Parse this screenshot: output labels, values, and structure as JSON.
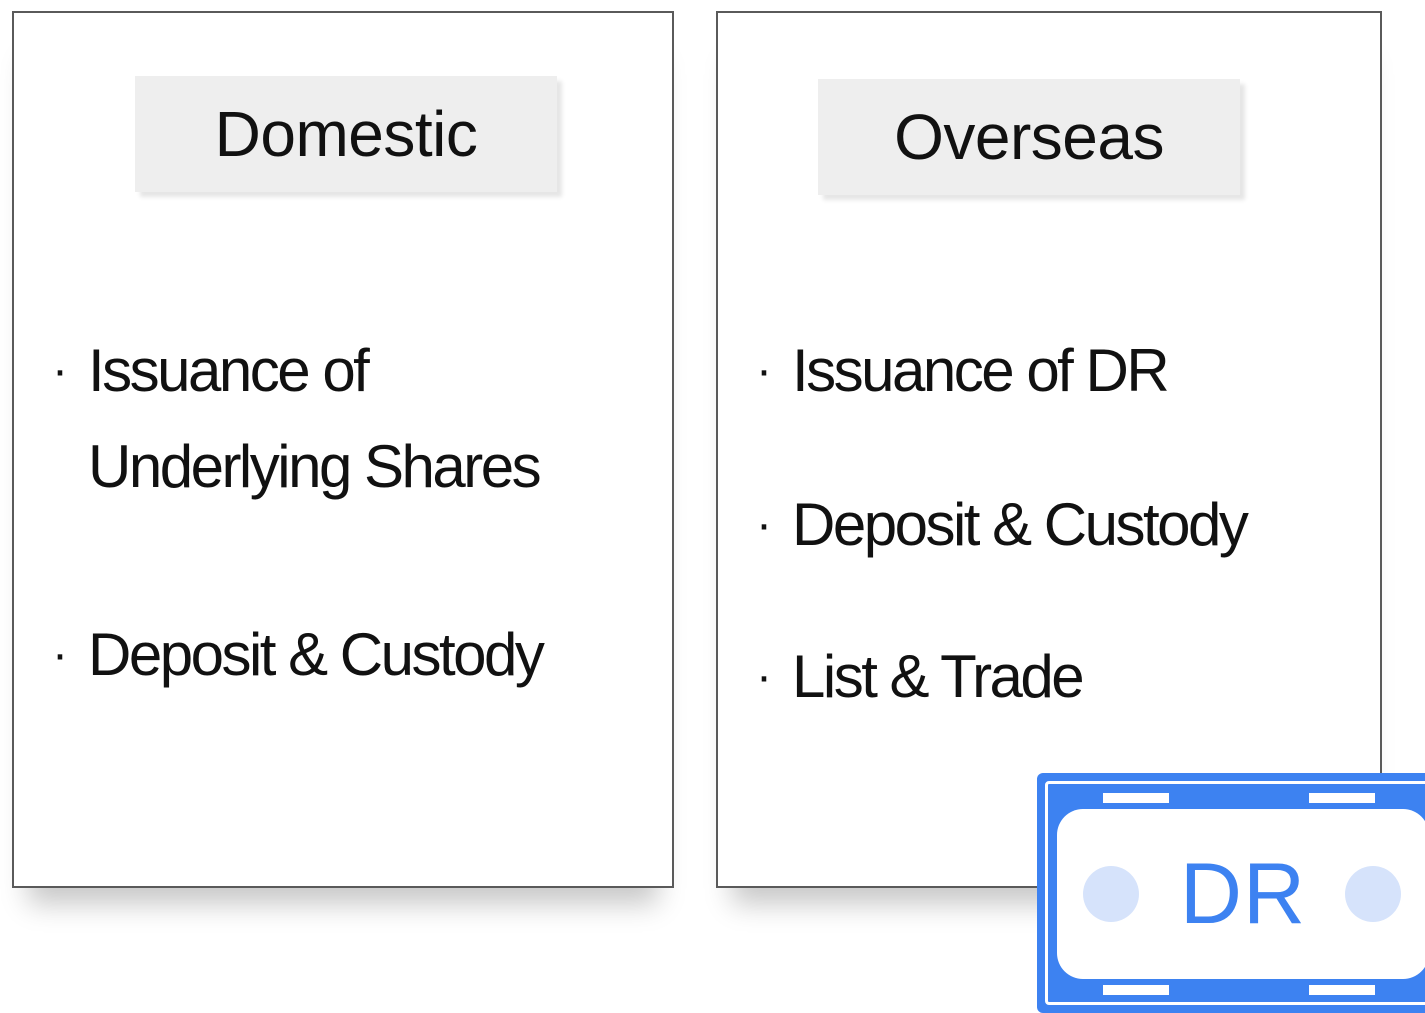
{
  "panels": {
    "domestic": {
      "title": "Domestic",
      "items": [
        {
          "line1": "Issuance of",
          "line2": "Underlying Shares"
        },
        {
          "line1": "Deposit & Custody"
        }
      ]
    },
    "overseas": {
      "title": "Overseas",
      "items": [
        {
          "line1": "Issuance of DR"
        },
        {
          "line1": "Deposit & Custody"
        },
        {
          "line1": "List & Trade"
        }
      ]
    }
  },
  "bullet_char": "·",
  "badge": {
    "label": "DR",
    "color": "#3d82f1",
    "circle_color": "#d6e3fb"
  }
}
